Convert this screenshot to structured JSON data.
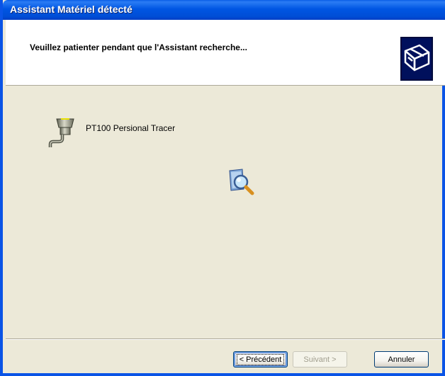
{
  "window": {
    "title": "Assistant Matériel détecté"
  },
  "header": {
    "title": "Veuillez patienter pendant que l'Assistant recherche...",
    "icon": "hardware-wizard-icon"
  },
  "content": {
    "device_name": "PT100 Persional Tracer",
    "device_icon": "serial-port-connector-icon",
    "progress_icon": "search-magnifier-icon"
  },
  "buttons": {
    "back": "< Précédent",
    "next": "Suivant >",
    "cancel": "Annuler"
  },
  "colors": {
    "titlebar": "#0054E3",
    "face": "#ECE9D8",
    "header": "#FFFFFF"
  }
}
